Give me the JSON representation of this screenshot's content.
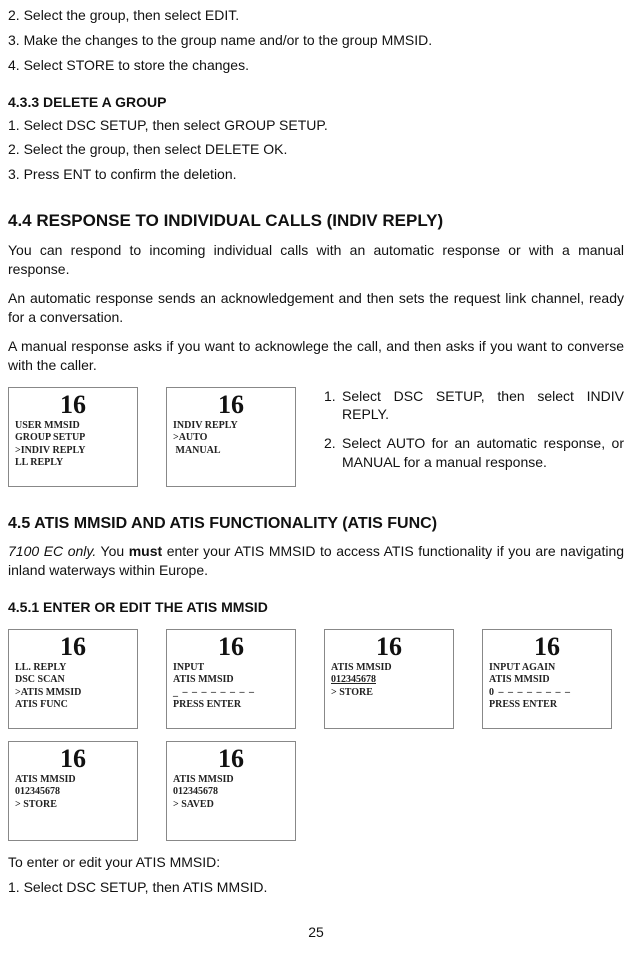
{
  "sec432": {
    "s2": "2. Select the group, then select EDIT.",
    "s3": "3. Make the changes to the group name and/or to the group MMSID.",
    "s4": "4.  Select STORE to store the changes."
  },
  "sec433": {
    "title": "4.3.3 DELETE A GROUP",
    "s1": "1.  Select DSC SETUP, then select GROUP SETUP.",
    "s2": "2. Select the group, then select DELETE OK.",
    "s3": "3.  Press ENT to confirm the deletion."
  },
  "sec44": {
    "title": "4.4 RESPONSE TO INDIVIDUAL CALLS (INDIV REPLY)",
    "p1": "You can respond to incoming individual calls with an automatic response or with a manual response.",
    "p2": "An automatic response sends an acknowledgement and then sets the request link channel, ready for a conversation.",
    "p3": "A manual response asks if you want to acknowlege the call, and then asks if you want to converse with the caller.",
    "screenA": {
      "ch": "16",
      "l1": "USER MMSID",
      "l2": "GROUP SETUP",
      "l3": ">INDIV REPLY",
      "l4": "LL REPLY"
    },
    "screenB": {
      "ch": "16",
      "l1": "INDIV REPLY",
      "l2": ">AUTO",
      "l3": " MANUAL"
    },
    "stepsA": "Select DSC SETUP, then select INDIV REPLY.",
    "stepsB": "Select AUTO for an automatic response, or MANUAL for a manual response."
  },
  "sec45": {
    "title": "4.5 ATIS MMSID AND ATIS FUNCTIONALITY (ATIS FUNC)",
    "lead_i": "7100 EC only.",
    "lead_mid": " You ",
    "lead_b": "must",
    "lead_end": " enter your ATIS MMSID to access ATIS functionality if you are navigating inland waterways within Europe."
  },
  "sec451": {
    "title": "4.5.1 ENTER OR EDIT THE ATIS MMSID",
    "sc1": {
      "ch": "16",
      "l1": "LL. REPLY",
      "l2": "DSC SCAN",
      "l3": ">ATIS MMSID",
      "l4": "ATIS FUNC"
    },
    "sc2": {
      "ch": "16",
      "l1": "INPUT",
      "l2": "ATIS MMSID",
      "l3": "_ – – – – – – – –",
      "l4": "PRESS ENTER"
    },
    "sc3": {
      "ch": "16",
      "l1": "ATIS MMSID",
      "l2": "012345678",
      "l3": "> STORE"
    },
    "sc4": {
      "ch": "16",
      "l1": "INPUT AGAIN",
      "l2": "ATIS MMSID",
      "l3": "0 – – – – – – – –",
      "l4": "PRESS ENTER"
    },
    "sc5": {
      "ch": "16",
      "l1": "ATIS MMSID",
      "l2": "012345678",
      "l3": "> STORE"
    },
    "sc6": {
      "ch": "16",
      "l1": "ATIS MMSID",
      "l2": "012345678",
      "l3": "> SAVED"
    },
    "postline": "To enter or edit your ATIS MMSID:",
    "s1": "1.  Select DSC SETUP, then ATIS MMSID."
  },
  "page": "25"
}
